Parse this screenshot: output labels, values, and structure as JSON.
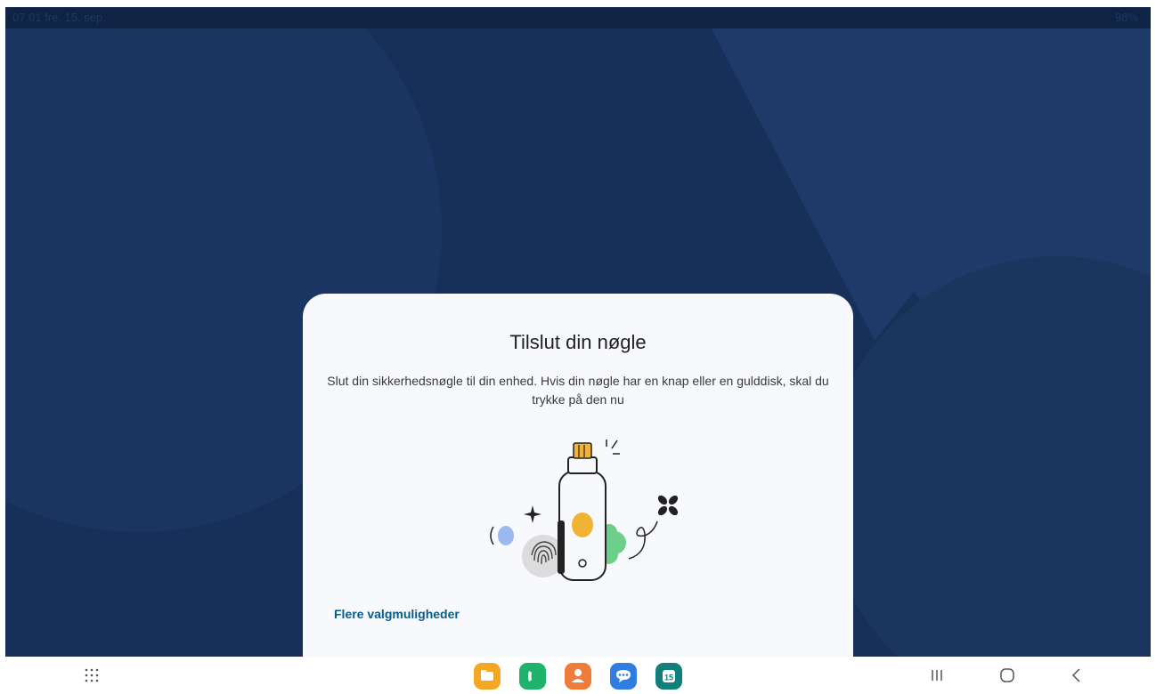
{
  "status_bar": {
    "left": "07.01  fre. 15. sep.",
    "right": "98%"
  },
  "dialog": {
    "title": "Tilslut din nøgle",
    "description": "Slut din sikkerhedsnøgle til din enhed. Hvis din nøgle har en knap eller en gulddisk, skal du trykke på den nu",
    "more_options": "Flere valgmuligheder"
  },
  "dock": {
    "apps": [
      {
        "icon": "folder-icon",
        "color": "#f5a623"
      },
      {
        "icon": "phone-icon",
        "color": "#1fb36b"
      },
      {
        "icon": "contacts-icon",
        "color": "#f07c3c"
      },
      {
        "icon": "messages-icon",
        "color": "#2f7de1"
      },
      {
        "icon": "calendar-icon",
        "color": "#12807a",
        "label": "15"
      }
    ]
  },
  "colors": {
    "background": "#17305a",
    "sheet": "#f7f9fc",
    "link": "#0b5b8a"
  }
}
